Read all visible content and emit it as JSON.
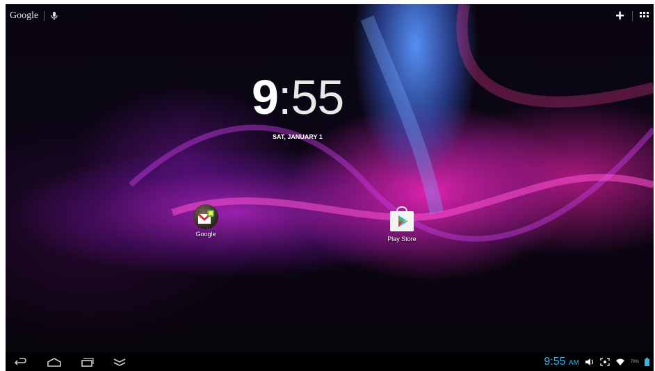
{
  "search_bar": {
    "label": "Google",
    "mic_icon": "microphone-icon"
  },
  "top_actions": {
    "add": "+",
    "apps_icon": "all-apps-icon"
  },
  "clock": {
    "hour": "9",
    "minute": ":55"
  },
  "date": "SAT, JANUARY 1",
  "desktop_icons": [
    {
      "label": "Google",
      "icon": "gmail-folder-icon"
    },
    {
      "label": "Play Store",
      "icon": "play-store-icon"
    }
  ],
  "nav_bar": {
    "icons": [
      "back-icon",
      "home-icon",
      "recents-icon",
      "hide-keyboard-icon"
    ]
  },
  "status_bar": {
    "time": "9:55",
    "ampm": "AM",
    "battery_text": "78%",
    "icons": [
      "volume-icon",
      "screenshot-icon",
      "wifi-icon",
      "battery-icon"
    ],
    "accent": "#33b5e5"
  }
}
